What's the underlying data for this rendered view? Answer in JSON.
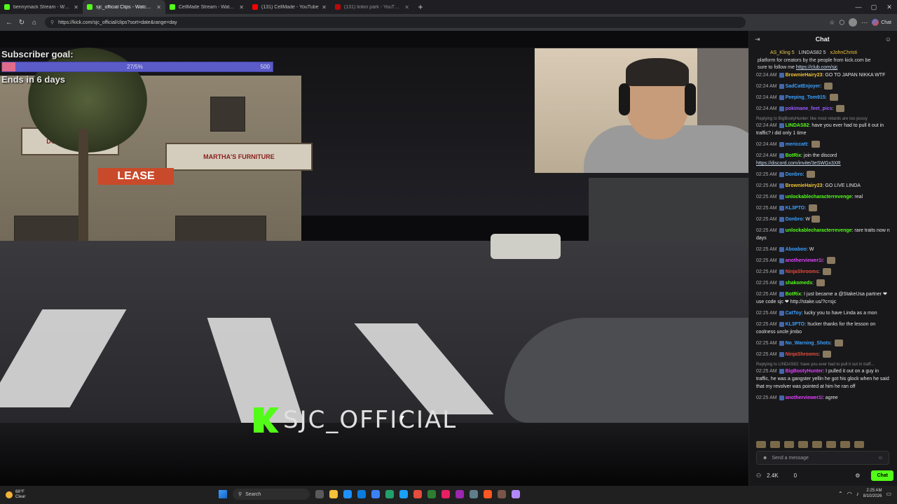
{
  "browser": {
    "tabs": [
      {
        "label": "bennymack Stream - Watch Li",
        "favicon": "kick",
        "active": false
      },
      {
        "label": "sjc_official Clips - Watch Live",
        "favicon": "kick",
        "active": true
      },
      {
        "label": "CellMade Stream - Watch Liv",
        "favicon": "kick",
        "active": false
      },
      {
        "label": "(131) CellMade - YouTube",
        "favicon": "yt",
        "active": false
      },
      {
        "label": "(131) linkin park - YouTube",
        "favicon": "yt",
        "active": false
      }
    ],
    "url": "https://kick.com/sjc_official/clips?sort=date&range=day",
    "chat_label": "Chat"
  },
  "stream": {
    "subscriber_goal_label": "Subscriber goal:",
    "goal_current": "27/5%",
    "goal_max": "500",
    "goal_fraction": 0.05,
    "ends_label": "Ends in 6 days",
    "channel_name": "SJC_OFFICIAL",
    "signs": {
      "lease": "LEASE",
      "shop1": "DONDE SONDA",
      "shop2": "MARTHA'S FURNITURE"
    }
  },
  "chat": {
    "title": "Chat",
    "top_users": [
      "AS_Kling 5",
      "LINDAS82 5",
      "xJohnChristi"
    ],
    "pinned_lines": [
      "platform for creators by the people from kick.com be",
      "sure to follow me"
    ],
    "pinned_link": "https://club.com/sjc",
    "messages": [
      {
        "time": "02:24 AM",
        "user": "BrownieHairy23",
        "color": "#f1c232",
        "text": "GO TO JAPAN NIKKA WTF",
        "reply": ""
      },
      {
        "time": "02:24 AM",
        "user": "SadCatEnjoyer",
        "color": "#3aa0ff",
        "text": "",
        "reply": "",
        "emote": true
      },
      {
        "time": "02:24 AM",
        "user": "Peeping_Tom915",
        "color": "#3aa0ff",
        "text": "",
        "reply": "",
        "emote": true
      },
      {
        "time": "02:24 AM",
        "user": "pokimane_feet_pics",
        "color": "#9b59ff",
        "text": "",
        "reply": "",
        "emote": true
      },
      {
        "time": "02:24 AM",
        "user": "LINDAS82",
        "color": "#53fc18",
        "text": "have you ever had to pull it out in traffic? i did only 1 time",
        "reply": "Replying to BigBootyHunter: like most retards are too pussy",
        "emote": false
      },
      {
        "time": "02:24 AM",
        "user": "mericcatt",
        "color": "#3aa0ff",
        "text": "",
        "reply": "",
        "emote": true
      },
      {
        "time": "02:24 AM",
        "user": "BotRix",
        "color": "#53fc18",
        "text": "join the discord",
        "link": "https://discord.com/invite/3eSWGx3XR",
        "reply": "",
        "emote": false
      },
      {
        "time": "02:25 AM",
        "user": "Donbro",
        "color": "#3aa0ff",
        "text": "",
        "reply": "",
        "emote": true
      },
      {
        "time": "02:25 AM",
        "user": "BrownieHairy23",
        "color": "#f1c232",
        "text": "GO LIVE LINDA",
        "reply": "",
        "emote": false
      },
      {
        "time": "02:25 AM",
        "user": "unlockablecharacterrevenge",
        "color": "#53fc18",
        "text": "real",
        "reply": "",
        "emote": false
      },
      {
        "time": "02:25 AM",
        "user": "KL3PTO",
        "color": "#3aa0ff",
        "text": "",
        "reply": "",
        "emote": true
      },
      {
        "time": "02:25 AM",
        "user": "Donbro",
        "color": "#3aa0ff",
        "text": "W",
        "reply": "",
        "emote": true
      },
      {
        "time": "02:25 AM",
        "user": "unlockablecharacterrevenge",
        "color": "#53fc18",
        "text": "rare traits now n days",
        "reply": "",
        "emote": false
      },
      {
        "time": "02:25 AM",
        "user": "Aboaboo",
        "color": "#3aa0ff",
        "text": "W",
        "reply": "",
        "emote": false
      },
      {
        "time": "02:25 AM",
        "user": "anotherviewer1i",
        "color": "#e040fb",
        "text": "",
        "reply": "",
        "emote": true
      },
      {
        "time": "02:25 AM",
        "user": "NinjaShrooms",
        "color": "#e74c3c",
        "text": "",
        "reply": "",
        "emote": true
      },
      {
        "time": "02:25 AM",
        "user": "shakomeds",
        "color": "#53fc18",
        "text": "",
        "reply": "",
        "emote": true
      },
      {
        "time": "02:25 AM",
        "user": "BotRix",
        "color": "#53fc18",
        "text": "I just became a @StakeUsa partner ❤ use code sjc ❤ http://stake.us/?c=sjc",
        "reply": "",
        "emote": false
      },
      {
        "time": "02:25 AM",
        "user": "CatToy",
        "color": "#3aa0ff",
        "text": "lucky you to have Linda as a mon",
        "reply": "",
        "emote": false
      },
      {
        "time": "02:25 AM",
        "user": "KL3PTO",
        "color": "#3aa0ff",
        "text": "!tucker thanks for the lesson on coolness uncle jimbo",
        "reply": "",
        "emote": false
      },
      {
        "time": "02:25 AM",
        "user": "No_Warning_Shots",
        "color": "#3aa0ff",
        "text": "",
        "reply": "",
        "emote": true
      },
      {
        "time": "02:25 AM",
        "user": "NinjaShrooms",
        "color": "#e74c3c",
        "text": "",
        "reply": "",
        "emote": true
      },
      {
        "time": "02:25 AM",
        "user": "BigBootyHunter",
        "color": "#e040fb",
        "text": "I pulled it out on a guy in traffic, he was a gangster yellin he got his glock when he said that my revolver was pointed at him he ran off",
        "reply": "Replying to LINDAS82: have you ever had to pull it out in traff...",
        "emote": false
      },
      {
        "time": "02:25 AM",
        "user": "anotherviewer1i",
        "color": "#e040fb",
        "text": "agree",
        "reply": "",
        "emote": false
      }
    ],
    "input_placeholder": "Send a message",
    "viewer_count": "2.4K",
    "secondary_count": "0",
    "send_label": "Chat"
  },
  "taskbar": {
    "temperature": "68°F",
    "weather": "Clear",
    "search_label": "Search",
    "time": "2:25 AM",
    "date": "8/10/2026"
  }
}
